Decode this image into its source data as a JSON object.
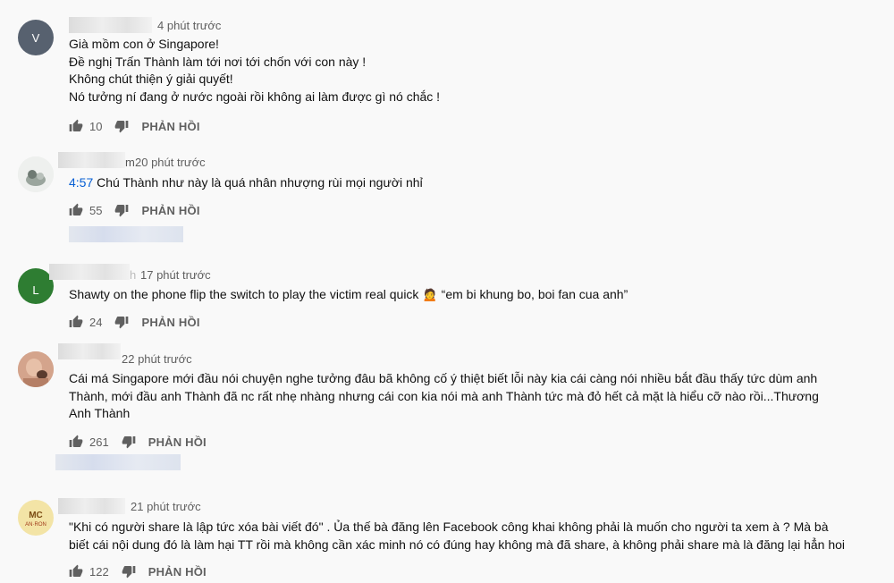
{
  "comments": [
    {
      "time": "4 phút trước",
      "avatar_letter": "V",
      "avatar_color": "#57616f",
      "lines": [
        "Già mồm con ở Singapore!",
        "Đề nghị Trấn Thành làm tới nơi tới chốn với con này !",
        "Không chút thiện ý giải quyết!",
        "Nó tưởng ní đang ở nước ngoài rồi không ai làm được gì nó chắc !"
      ],
      "likes": "10",
      "reply_label": "PHẢN HỒI"
    },
    {
      "author_tail": "m",
      "time": "20 phút trước",
      "timestamp_link": "4:57",
      "text": " Chú Thành như này là quá nhân nhượng rùi mọi người nhỉ",
      "likes": "55",
      "reply_label": "PHẢN HỒI"
    },
    {
      "author_tail": "h",
      "time": "17 phút trước",
      "avatar_letter": "L",
      "avatar_color": "#2e7d32",
      "text": "Shawty on the phone flip the switch to play the victim real quick",
      "emoji": "🙍",
      "text_after": " “em bi khung bo, boi fan cua anh”",
      "likes": "24",
      "reply_label": "PHẢN HỒI"
    },
    {
      "time": "22 phút trước",
      "text": "Cái má Singapore mới đầu nói chuyện nghe tưởng đâu bã không cố ý thiệt biết lỗi này kia cái càng nói nhiều bắt đầu thấy tức dùm anh Thành, mới đầu anh Thành đã nc rất nhẹ nhàng nhưng cái con kia nói mà anh Thành tức mà đỏ hết cả mặt là hiểu cỡ nào rồi...Thương Anh Thành",
      "likes": "261",
      "reply_label": "PHẢN HỒI"
    },
    {
      "time": "21 phút trước",
      "avatar_top_text": "MC",
      "avatar_bottom_text": "AN·RON",
      "text": "\"Khi có người share là lập tức xóa bài viết đó\" . Ủa thế bà đăng lên Facebook công khai không phải là muốn cho người ta xem à ? Mà bà biết cái nội dung đó là làm hại TT rồi mà không cần xác minh nó có đúng hay không mà đã share, à không phải share mà là đăng lại hẳn hoi",
      "likes": "122",
      "reply_label": "PHẢN HỒI"
    }
  ],
  "icons": {
    "like": "thumb-up-icon",
    "dislike": "thumb-down-icon"
  }
}
